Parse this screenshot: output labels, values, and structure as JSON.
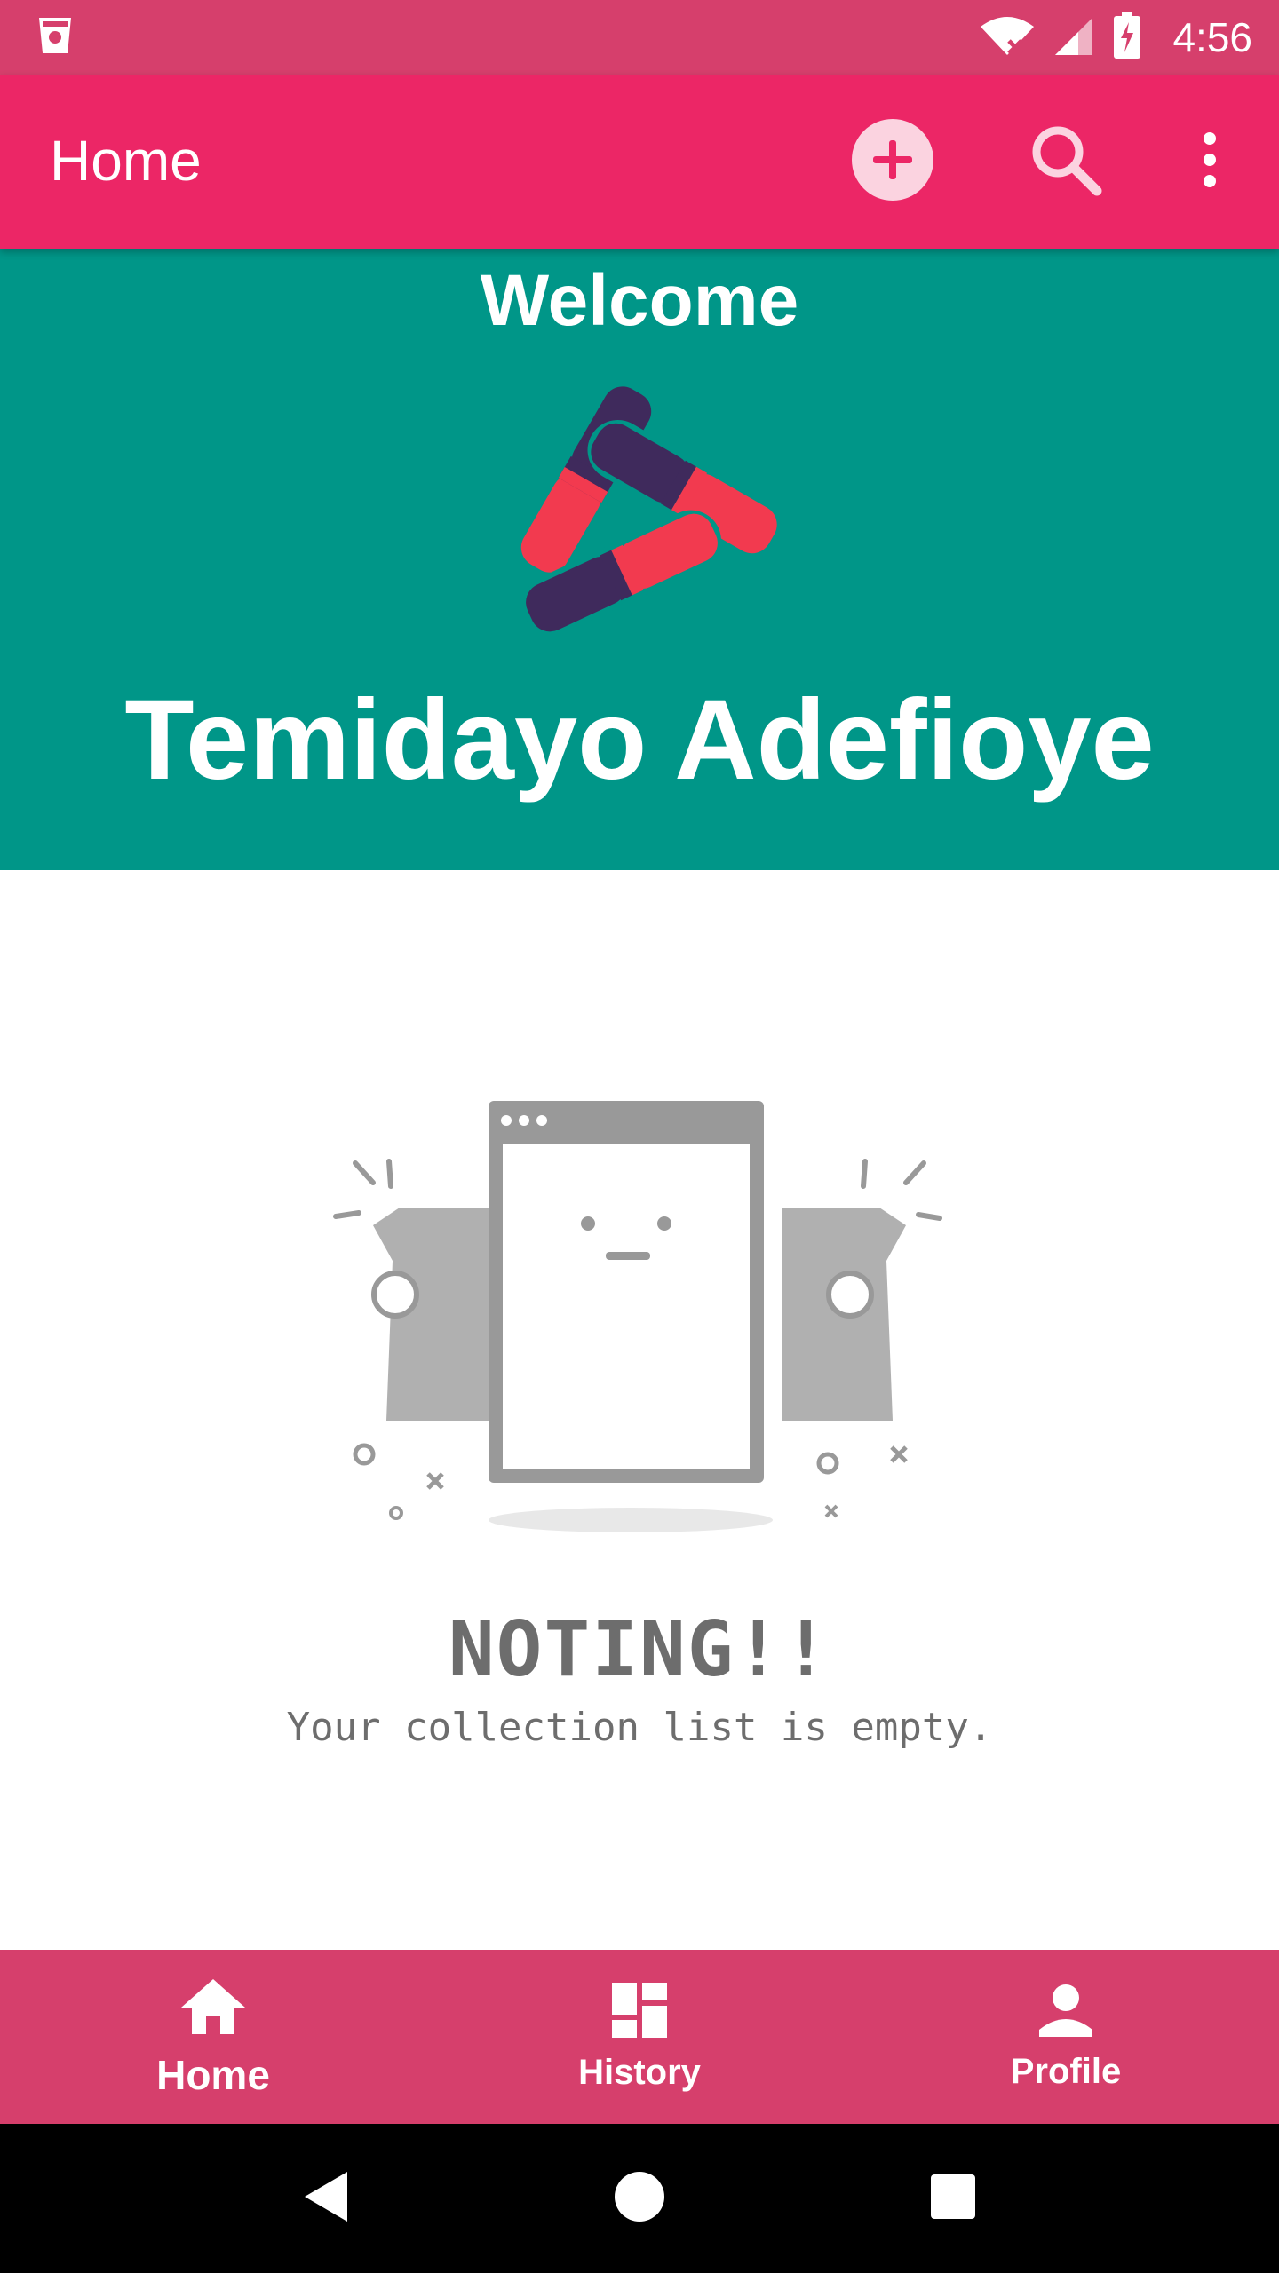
{
  "status_bar": {
    "time": "4:56",
    "icons": [
      "sim-card-icon",
      "wifi-icon",
      "signal-icon",
      "battery-charging-icon"
    ]
  },
  "app_bar": {
    "title": "Home",
    "actions": [
      "add-circle-icon",
      "search-icon",
      "more-vert-icon"
    ]
  },
  "banner": {
    "welcome": "Welcome",
    "user_name": "Temidayo Adefioye"
  },
  "empty_state": {
    "title": "NOTING!!",
    "subtitle": "Your collection list is empty."
  },
  "bottom_nav": {
    "items": [
      {
        "label": "Home",
        "icon": "home-icon",
        "active": true
      },
      {
        "label": "History",
        "icon": "dashboard-icon",
        "active": false
      },
      {
        "label": "Profile",
        "icon": "person-icon",
        "active": false
      }
    ]
  },
  "system_nav": [
    "back-icon",
    "home-circle-icon",
    "recents-icon"
  ],
  "colors": {
    "status_bar": "#d63f6c",
    "app_bar": "#ec2666",
    "banner": "#009688",
    "bottom_nav": "#d63f6c",
    "logo_red": "#f23a4f",
    "logo_purple": "#3f2a5c"
  }
}
